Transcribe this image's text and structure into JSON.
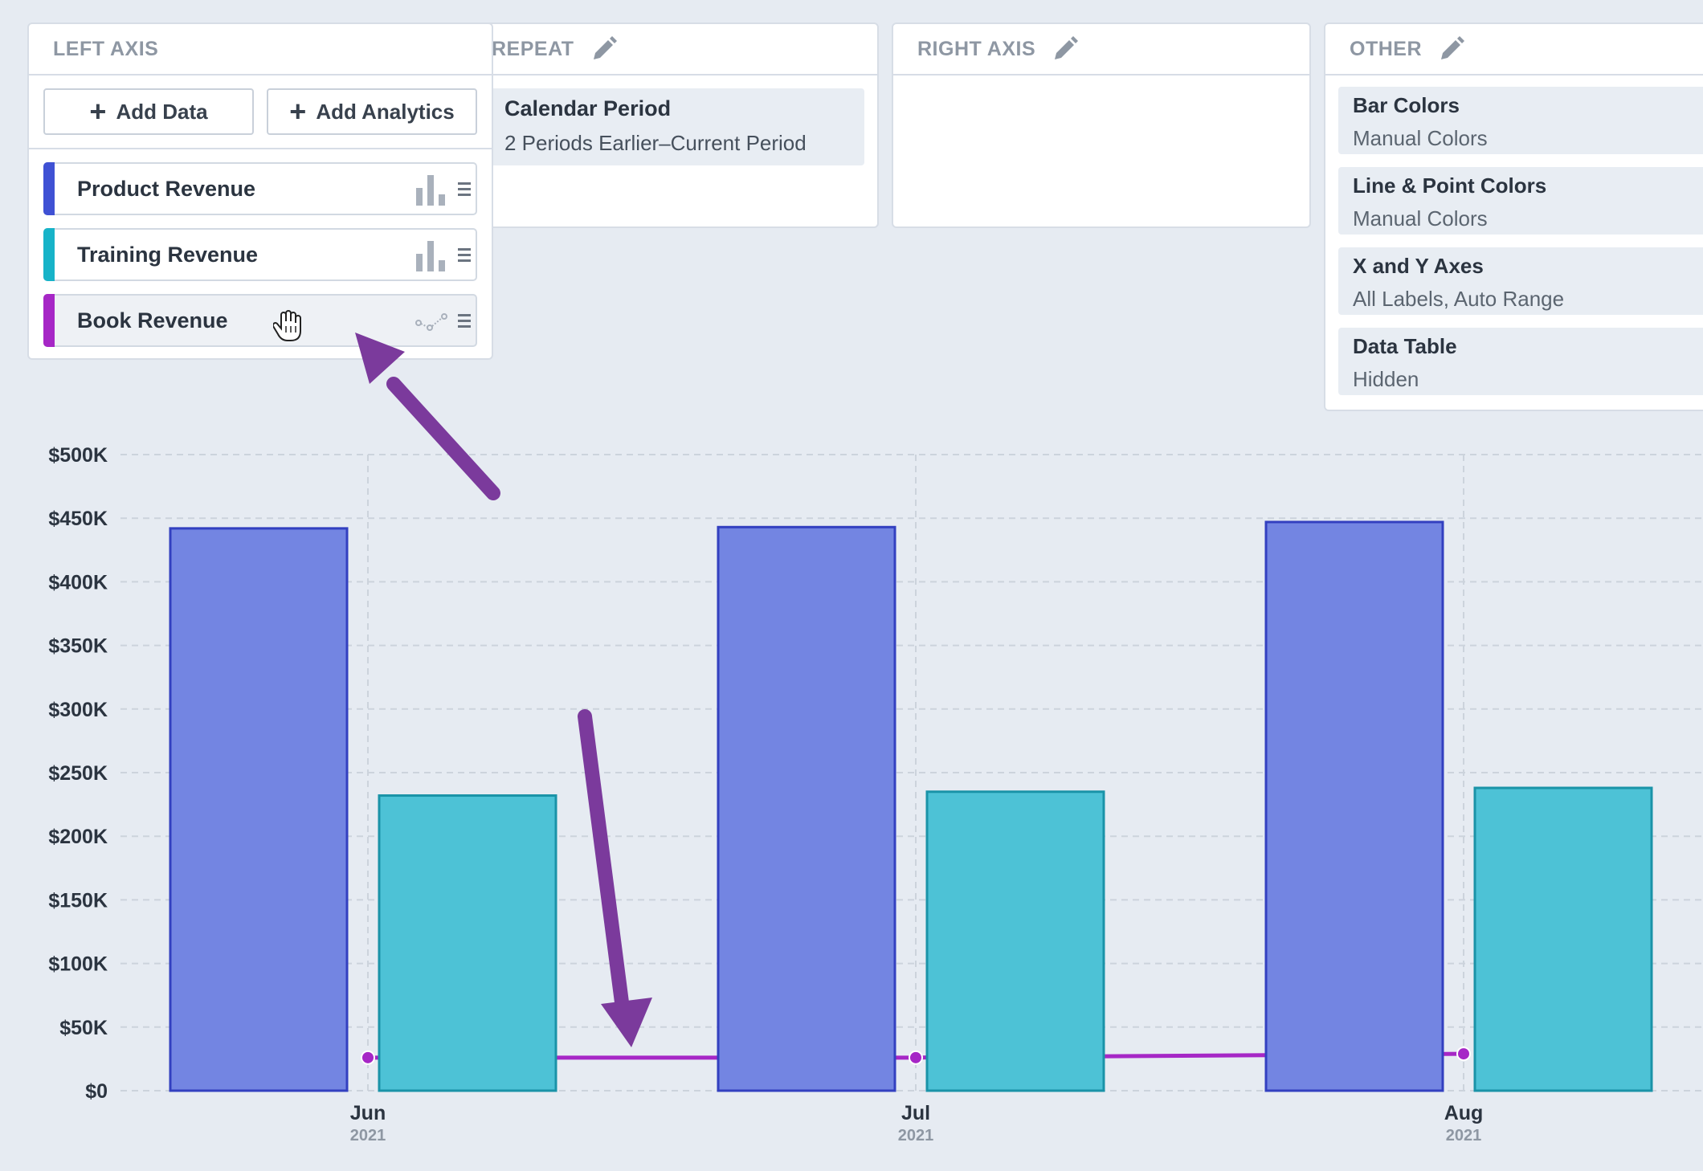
{
  "left_axis": {
    "title": "LEFT AXIS",
    "add_data_label": "Add Data",
    "add_analytics_label": "Add Analytics",
    "series": [
      {
        "label": "Product Revenue",
        "color": "#3f51d4",
        "type_icon": "bar-chart-icon"
      },
      {
        "label": "Training Revenue",
        "color": "#17b3c8",
        "type_icon": "bar-chart-icon"
      },
      {
        "label": "Book Revenue",
        "color": "#a627c6",
        "type_icon": "scatter-line-icon"
      }
    ]
  },
  "repeat": {
    "title": "REPEAT",
    "card_title": "Calendar Period",
    "card_sub": "2 Periods Earlier–Current Period"
  },
  "right_axis": {
    "title": "RIGHT AXIS"
  },
  "other": {
    "title": "OTHER",
    "items": [
      {
        "title": "Bar Colors",
        "sub": "Manual Colors"
      },
      {
        "title": "Line & Point Colors",
        "sub": "Manual Colors"
      },
      {
        "title": "X and Y Axes",
        "sub": "All Labels, Auto Range"
      },
      {
        "title": "Data Table",
        "sub": "Hidden"
      }
    ]
  },
  "colors": {
    "product_fill": "#7385e2",
    "product_stroke": "#3340c0",
    "training_fill": "#4dc2d6",
    "training_stroke": "#1a93a8",
    "book_line": "#a627c6",
    "annotation_arrow": "#7b3a9c"
  },
  "chart_data": {
    "type": "bar",
    "categories": [
      "Jun",
      "Jul",
      "Aug"
    ],
    "category_years": [
      "2021",
      "2021",
      "2021"
    ],
    "ylim": [
      0,
      500000
    ],
    "yticks": [
      "$0",
      "$50K",
      "$100K",
      "$150K",
      "$200K",
      "$250K",
      "$300K",
      "$350K",
      "$400K",
      "$450K",
      "$500K"
    ],
    "series": [
      {
        "name": "Product Revenue",
        "type": "bar",
        "values": [
          442000,
          443000,
          447000
        ]
      },
      {
        "name": "Training Revenue",
        "type": "bar",
        "values": [
          232000,
          235000,
          238000
        ]
      },
      {
        "name": "Book Revenue",
        "type": "line",
        "values": [
          26000,
          26000,
          29000
        ]
      }
    ],
    "grid": true
  }
}
